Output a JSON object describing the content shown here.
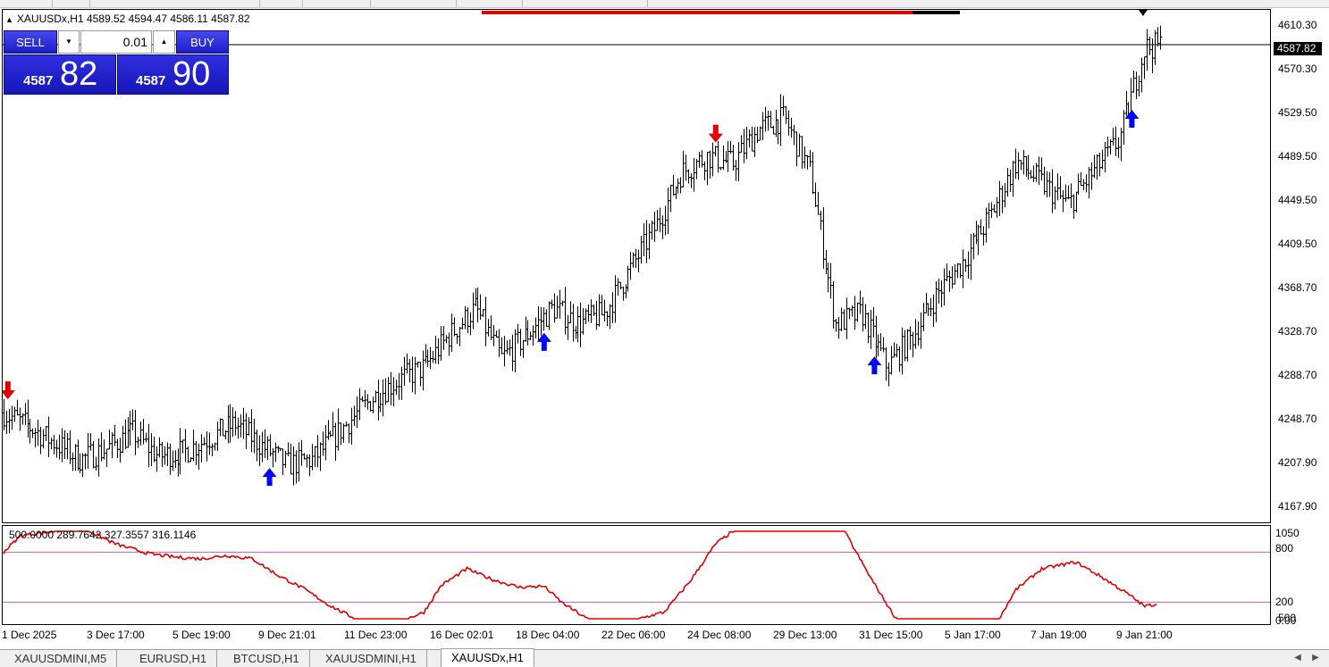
{
  "window": {
    "symbol_info": "XAUUSDx,H1  4589.52 4594.47 4586.11 4587.82"
  },
  "trade_panel": {
    "sell_label": "SELL",
    "buy_label": "BUY",
    "lot_value": "0.01",
    "sell_price_prefix": "4587",
    "sell_price_big": "82",
    "buy_price_prefix": "4587",
    "buy_price_big": "90"
  },
  "price_axis": {
    "labels": [
      "4610.30",
      "4570.30",
      "4529.50",
      "4489.50",
      "4449.50",
      "4409.50",
      "4368.70",
      "4328.70",
      "4288.70",
      "4248.70",
      "4207.90",
      "4167.90"
    ],
    "current_price": "4587.82"
  },
  "indicator": {
    "values_text": "500.0000 289.7642 327.3557 316.1146",
    "axis_labels": [
      "1050",
      "800",
      "200",
      "500",
      "0.00"
    ]
  },
  "time_axis": {
    "labels": [
      "1 Dec 2025",
      "3 Dec 17:00",
      "5 Dec 19:00",
      "9 Dec 21:01",
      "11 Dec 23:00",
      "16 Dec 02:01",
      "18 Dec 04:00",
      "22 Dec 06:00",
      "24 Dec 08:00",
      "29 Dec 13:00",
      "31 Dec 15:00",
      "5 Jan 17:00",
      "7 Jan 19:00",
      "9 Jan 21:00"
    ]
  },
  "tabs": [
    {
      "label": "XAUUSDMINI,M5",
      "active": false
    },
    {
      "label": "EURUSD,H1",
      "active": false
    },
    {
      "label": "BTCUSD,H1",
      "active": false
    },
    {
      "label": "XAUUSDMINI,H1",
      "active": false
    },
    {
      "label": "XAUUSDx,H1",
      "active": true
    }
  ],
  "colors": {
    "buy_arrow": "#0000ff",
    "sell_arrow": "#e00000",
    "indicator_line": "#e00000",
    "level_line": "#c060c0",
    "panel_blue": "#2424d0"
  },
  "chart_data": {
    "type": "line",
    "description_series": "XAUUSDx H1 price (approx. close path)",
    "y_range": [
      4147.0,
      4620.0
    ],
    "x_labels": [
      "1 Dec 2025",
      "3 Dec 17:00",
      "5 Dec 19:00",
      "9 Dec 21:01",
      "11 Dec 23:00",
      "16 Dec 02:01",
      "18 Dec 04:00",
      "22 Dec 06:00",
      "24 Dec 08:00",
      "29 Dec 13:00",
      "31 Dec 15:00",
      "5 Jan 17:00",
      "7 Jan 19:00",
      "9 Jan 21:00"
    ],
    "price_path": [
      [
        0,
        4248
      ],
      [
        0.3,
        4235
      ],
      [
        0.6,
        4220
      ],
      [
        0.9,
        4205
      ],
      [
        1.2,
        4215
      ],
      [
        1.5,
        4230
      ],
      [
        1.8,
        4208
      ],
      [
        2.1,
        4212
      ],
      [
        2.4,
        4225
      ],
      [
        2.7,
        4238
      ],
      [
        3.0,
        4218
      ],
      [
        3.3,
        4200
      ],
      [
        3.6,
        4205
      ],
      [
        4.0,
        4238
      ],
      [
        4.3,
        4262
      ],
      [
        4.6,
        4278
      ],
      [
        4.9,
        4290
      ],
      [
        5.2,
        4320
      ],
      [
        5.5,
        4345
      ],
      [
        5.8,
        4298
      ],
      [
        6.1,
        4320
      ],
      [
        6.4,
        4345
      ],
      [
        6.7,
        4330
      ],
      [
        7.0,
        4340
      ],
      [
        7.3,
        4380
      ],
      [
        7.6,
        4420
      ],
      [
        7.9,
        4470
      ],
      [
        8.2,
        4485
      ],
      [
        8.5,
        4478
      ],
      [
        8.8,
        4510
      ],
      [
        9.1,
        4520
      ],
      [
        9.4,
        4470
      ],
      [
        9.7,
        4330
      ],
      [
        10.0,
        4340
      ],
      [
        10.3,
        4290
      ],
      [
        10.6,
        4320
      ],
      [
        10.9,
        4360
      ],
      [
        11.2,
        4390
      ],
      [
        11.5,
        4430
      ],
      [
        11.8,
        4480
      ],
      [
        12.1,
        4460
      ],
      [
        12.4,
        4440
      ],
      [
        12.7,
        4470
      ],
      [
        13.0,
        4500
      ],
      [
        13.3,
        4585
      ],
      [
        13.5,
        4588
      ]
    ],
    "indicator_levels": [
      800,
      200
    ],
    "indicator_range": [
      0,
      1050
    ],
    "indicator_path": [
      [
        0,
        800
      ],
      [
        0.2,
        1000
      ],
      [
        0.6,
        1050
      ],
      [
        1.0,
        1050
      ],
      [
        1.3,
        900
      ],
      [
        1.7,
        780
      ],
      [
        2.0,
        740
      ],
      [
        2.3,
        720
      ],
      [
        2.6,
        760
      ],
      [
        2.9,
        720
      ],
      [
        3.2,
        520
      ],
      [
        3.5,
        360
      ],
      [
        3.8,
        160
      ],
      [
        4.1,
        0
      ],
      [
        4.4,
        0
      ],
      [
        4.7,
        0
      ],
      [
        4.9,
        80
      ],
      [
        5.1,
        400
      ],
      [
        5.4,
        600
      ],
      [
        5.7,
        470
      ],
      [
        6.0,
        380
      ],
      [
        6.3,
        390
      ],
      [
        6.5,
        200
      ],
      [
        6.8,
        0
      ],
      [
        7.1,
        0
      ],
      [
        7.4,
        0
      ],
      [
        7.7,
        80
      ],
      [
        8.0,
        450
      ],
      [
        8.3,
        900
      ],
      [
        8.5,
        1050
      ],
      [
        9.0,
        1050
      ],
      [
        9.8,
        1050
      ],
      [
        10.1,
        500
      ],
      [
        10.4,
        0
      ],
      [
        10.8,
        0
      ],
      [
        11.2,
        0
      ],
      [
        11.6,
        0
      ],
      [
        11.8,
        350
      ],
      [
        12.1,
        600
      ],
      [
        12.5,
        680
      ],
      [
        12.8,
        500
      ],
      [
        13.1,
        300
      ],
      [
        13.3,
        150
      ],
      [
        13.45,
        180
      ]
    ],
    "signals": [
      {
        "type": "sell",
        "x": 0.05
      },
      {
        "type": "buy",
        "x": 3.1
      },
      {
        "type": "buy",
        "x": 6.3
      },
      {
        "type": "sell",
        "x": 8.3
      },
      {
        "type": "buy",
        "x": 10.15
      },
      {
        "type": "buy",
        "x": 13.15
      }
    ]
  }
}
